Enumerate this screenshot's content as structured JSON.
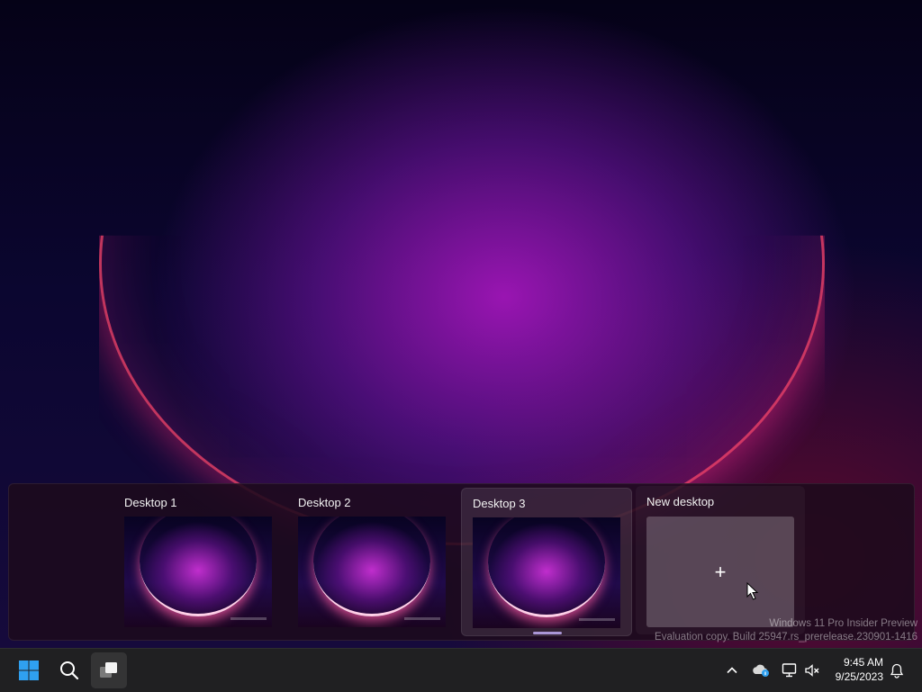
{
  "desktops": [
    {
      "label": "Desktop 1",
      "active": false
    },
    {
      "label": "Desktop 2",
      "active": false
    },
    {
      "label": "Desktop 3",
      "active": true
    }
  ],
  "new_desktop": {
    "label": "New desktop",
    "plus": "+"
  },
  "watermark": {
    "line1": "Windows 11 Pro Insider Preview",
    "line2": "Evaluation copy. Build 25947.rs_prerelease.230901-1416"
  },
  "taskbar": {
    "icons": [
      "windows-start-icon",
      "search-icon",
      "task-view-icon"
    ],
    "tray_icons": [
      "chevron-up-icon",
      "onedrive-icon",
      "network-icon",
      "volume-muted-icon",
      "notification-bell-icon"
    ],
    "time": "9:45 AM",
    "date": "9/25/2023"
  },
  "colors": {
    "taskbar": "#202022",
    "accent_blue": "#2fa0f0",
    "scroll_indicator": "#c8b4ff"
  }
}
